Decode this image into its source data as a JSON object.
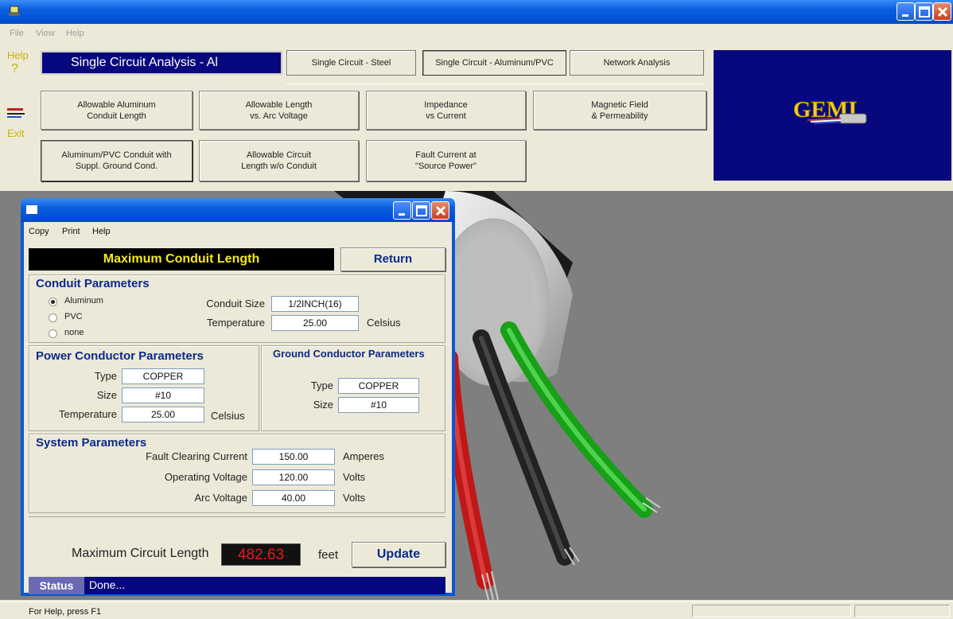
{
  "menu": {
    "file": "File",
    "view": "View",
    "help": "Help"
  },
  "sidebar": {
    "help": "Help",
    "question": "?",
    "exit": "Exit"
  },
  "tabs": {
    "title": "Single Circuit Analysis - Al",
    "steel": "Single Circuit - Steel",
    "aluminum_pvc": "Single Circuit - Aluminum/PVC",
    "network": "Network Analysis"
  },
  "buttons": {
    "allowable_aluminum": "Allowable Aluminum\nConduit Length",
    "allowable_length": "Allowable Length\nvs. Arc Voltage",
    "impedance": "Impedance\nvs Current",
    "magnetic": "Magnetic Field\n& Permeability",
    "suppl_ground": "Aluminum/PVC Conduit with\nSuppl. Ground Cond.",
    "allowable_circuit": "Allowable Circuit\nLength w/o Conduit",
    "fault_current": "Fault Current at\n\"Source Power\""
  },
  "logo": "GEMI",
  "statusbar": {
    "text": "For Help, press F1"
  },
  "dialog": {
    "menu": {
      "copy": "Copy",
      "print": "Print",
      "help": "Help"
    },
    "heading": "Maximum Conduit Length",
    "return_label": "Return",
    "conduit": {
      "title": "Conduit Parameters",
      "options": [
        "Aluminum",
        "PVC",
        "none"
      ],
      "selected": "Aluminum",
      "size_label": "Conduit Size",
      "size_value": "1/2INCH(16)",
      "temp_label": "Temperature",
      "temp_value": "25.00",
      "temp_unit": "Celsius"
    },
    "power": {
      "title": "Power Conductor Parameters",
      "type_label": "Type",
      "type_value": "COPPER",
      "size_label": "Size",
      "size_value": "#10",
      "temp_label": "Temperature",
      "temp_value": "25.00",
      "temp_unit": "Celsius"
    },
    "ground": {
      "title": "Ground Conductor Parameters",
      "type_label": "Type",
      "type_value": "COPPER",
      "size_label": "Size",
      "size_value": "#10"
    },
    "system": {
      "title": "System Parameters",
      "fault_label": "Fault Clearing Current",
      "fault_value": "150.00",
      "fault_unit": "Amperes",
      "voltage_label": "Operating Voltage",
      "voltage_value": "120.00",
      "voltage_unit": "Volts",
      "arc_label": "Arc Voltage",
      "arc_value": "40.00",
      "arc_unit": "Volts"
    },
    "result": {
      "label": "Maximum Circuit Length",
      "value": "482.63",
      "unit": "feet",
      "update_label": "Update"
    },
    "status": {
      "label": "Status",
      "text": "Done..."
    }
  },
  "colors": {
    "title_blue": "#08087e",
    "result_red": "#e81a1a",
    "heading_yellow": "#f7ea1a",
    "group_title_blue": "#0c2a8a"
  }
}
